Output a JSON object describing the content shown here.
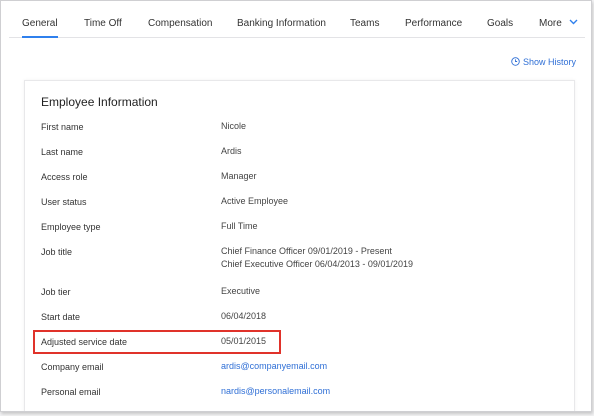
{
  "tabs": [
    {
      "label": "General"
    },
    {
      "label": "Time Off"
    },
    {
      "label": "Compensation"
    },
    {
      "label": "Banking Information"
    },
    {
      "label": "Teams"
    },
    {
      "label": "Performance"
    },
    {
      "label": "Goals"
    },
    {
      "label": "More"
    }
  ],
  "active_tab": "General",
  "show_history": {
    "label": "Show History",
    "icon": "clock-icon"
  },
  "section": {
    "title": "Employee Information"
  },
  "fields": {
    "first_name": {
      "label": "First name",
      "value": "Nicole"
    },
    "last_name": {
      "label": "Last name",
      "value": "Ardis"
    },
    "access_role": {
      "label": "Access role",
      "value": "Manager"
    },
    "user_status": {
      "label": "User status",
      "value": "Active Employee"
    },
    "employee_type": {
      "label": "Employee type",
      "value": "Full Time"
    },
    "job_title": {
      "label": "Job title",
      "values": [
        "Chief Finance Officer 09/01/2019 - Present",
        "Chief Executive Officer 06/04/2013 - 09/01/2019"
      ]
    },
    "job_tier": {
      "label": "Job tier",
      "value": "Executive"
    },
    "start_date": {
      "label": "Start date",
      "value": "06/04/2018"
    },
    "adjusted_service_date": {
      "label": "Adjusted service date",
      "value": "05/01/2015"
    },
    "company_email": {
      "label": "Company email",
      "value": "ardis@companyemail.com"
    },
    "personal_email": {
      "label": "Personal email",
      "value": "nardis@personalemail.com"
    }
  },
  "colors": {
    "accent": "#2f80ed",
    "link": "#2f6fd6",
    "highlight": "#e0322a"
  }
}
